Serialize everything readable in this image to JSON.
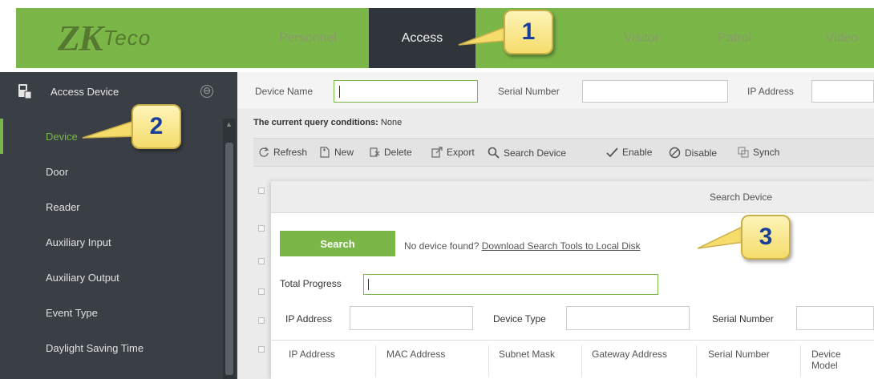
{
  "brand": {
    "logo_main": "ZK",
    "logo_sub": "Teco"
  },
  "nav": {
    "tabs": [
      {
        "label": "Personnel",
        "active": false
      },
      {
        "label": "Access",
        "active": true
      },
      {
        "label": "Visitor",
        "active": false
      },
      {
        "label": "Patrol",
        "active": false
      },
      {
        "label": "Video",
        "active": false
      }
    ]
  },
  "sidebar": {
    "group_label": "Access Device",
    "group_icon": "device-icon",
    "collapse_glyph": "⊖",
    "items": [
      {
        "label": "Device",
        "active": true
      },
      {
        "label": "Door",
        "active": false
      },
      {
        "label": "Reader",
        "active": false
      },
      {
        "label": "Auxiliary Input",
        "active": false
      },
      {
        "label": "Auxiliary Output",
        "active": false
      },
      {
        "label": "Event Type",
        "active": false
      },
      {
        "label": "Daylight Saving Time",
        "active": false
      }
    ]
  },
  "query": {
    "device_name_label": "Device Name",
    "serial_number_label": "Serial Number",
    "ip_address_label": "IP Address",
    "conditions_label": "The current query conditions:",
    "conditions_value": "None"
  },
  "toolbar": {
    "refresh": "Refresh",
    "new": "New",
    "delete": "Delete",
    "export": "Export",
    "search_device": "Search Device",
    "enable": "Enable",
    "disable": "Disable",
    "sync": "Synch"
  },
  "dialog": {
    "title": "Search Device",
    "search_button": "Search",
    "no_device_text": "No device found?",
    "download_link": "Download Search Tools to Local Disk",
    "total_progress_label": "Total Progress",
    "total_progress_value": 0,
    "filters": {
      "ip_address_label": "IP Address",
      "device_type_label": "Device Type",
      "serial_number_label": "Serial Number"
    },
    "columns": [
      "IP Address",
      "MAC Address",
      "Subnet Mask",
      "Gateway Address",
      "Serial Number",
      "Device\nModel"
    ]
  },
  "callouts": [
    "1",
    "2",
    "3"
  ],
  "colors": {
    "brand_green": "#7ab648",
    "sidebar_bg": "#3a3f45",
    "active_tab_bg": "#30353b",
    "callout_fill": "#f5dc6b",
    "callout_text": "#1a3f9a"
  }
}
